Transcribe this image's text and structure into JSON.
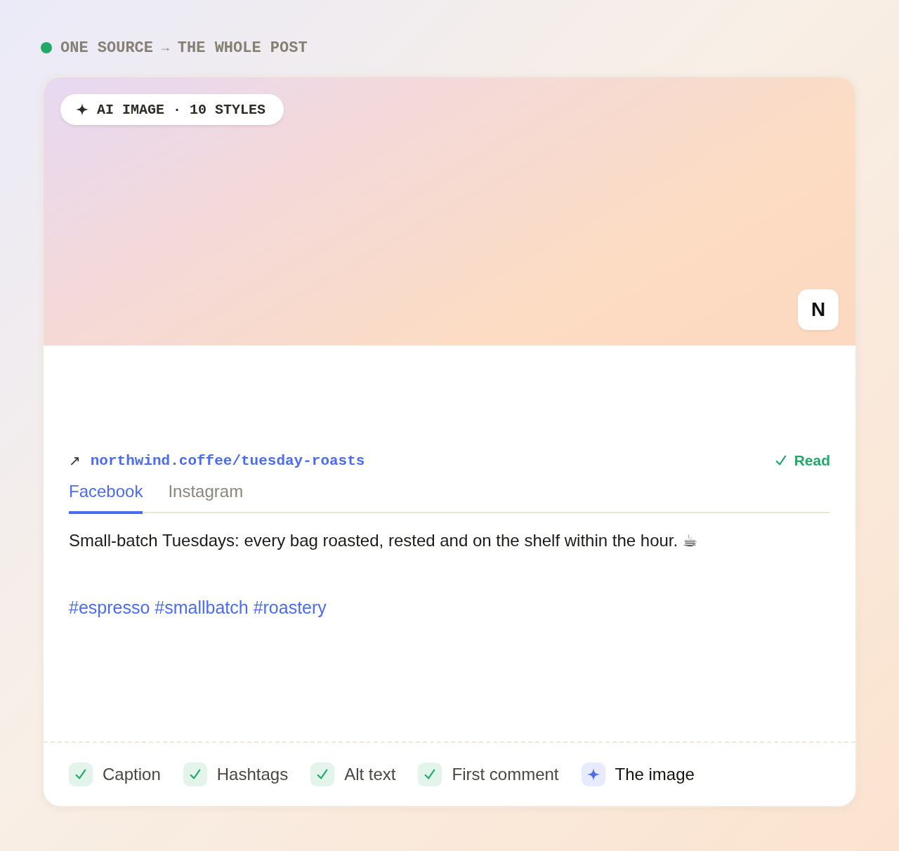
{
  "header": {
    "source": "ONE SOURCE",
    "arrow": "→",
    "target": "THE WHOLE POST"
  },
  "image": {
    "badge": "AI IMAGE · 10 STYLES",
    "avatar": "N"
  },
  "link": {
    "arrow": "↗",
    "url": "northwind.coffee/tuesday-roasts",
    "status": "Read"
  },
  "tabs": [
    {
      "label": "Facebook",
      "selected": true
    },
    {
      "label": "Instagram",
      "selected": false
    }
  ],
  "caption": "Small-batch Tuesdays: every bag roasted, rested and on the shelf within the hour. ☕",
  "hashtags": "#espresso #smallbatch #roastery",
  "checklist": [
    {
      "label": "Caption",
      "kind": "done"
    },
    {
      "label": "Hashtags",
      "kind": "done"
    },
    {
      "label": "Alt text",
      "kind": "done"
    },
    {
      "label": "First comment",
      "kind": "done"
    },
    {
      "label": "The image",
      "kind": "generating"
    }
  ]
}
